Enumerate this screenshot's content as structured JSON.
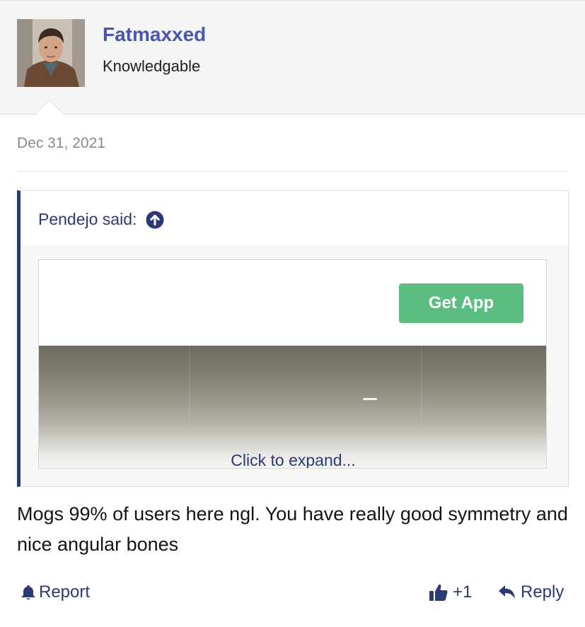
{
  "user": {
    "name": "Fatmaxxed",
    "title": "Knowledgable"
  },
  "post": {
    "date": "Dec 31, 2021",
    "body": "Mogs 99% of users here ngl. You have really good symmetry and nice angular bones"
  },
  "quote": {
    "author_label": "Pendejo said:",
    "embed_button": "Get App",
    "expand_label": "Click to expand..."
  },
  "footer": {
    "report_label": "Report",
    "like_count": "+1",
    "reply_label": "Reply"
  },
  "colors": {
    "username": "#4a56ad",
    "link": "#2c3a73",
    "button": "#5bbd7f"
  },
  "icons": [
    "bell-icon",
    "thumbs-up-icon",
    "reply-arrow-icon",
    "arrow-up-circle-icon"
  ]
}
